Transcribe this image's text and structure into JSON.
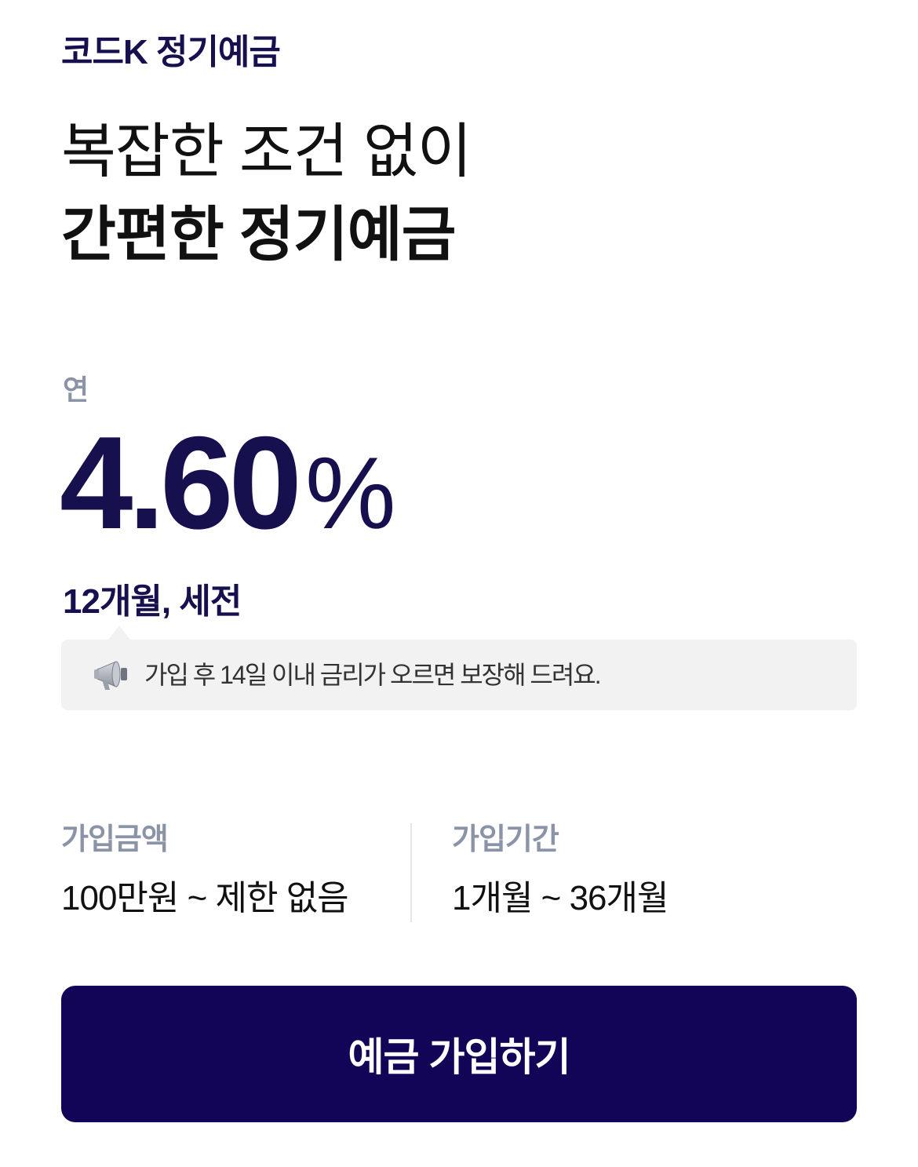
{
  "header": {
    "product_name": "코드K 정기예금"
  },
  "headline": {
    "line1": "복잡한 조건 없이",
    "line2": "간편한 정기예금"
  },
  "rate": {
    "prefix": "연",
    "value": "4.60",
    "unit": "%",
    "condition": "12개월, 세전"
  },
  "notice": {
    "icon": "megaphone-icon",
    "text": "가입 후 14일 이내 금리가 오르면 보장해 드려요."
  },
  "info": {
    "amount": {
      "label": "가입금액",
      "value": "100만원 ~ 제한 없음"
    },
    "period": {
      "label": "가입기간",
      "value": "1개월 ~ 36개월"
    }
  },
  "cta": {
    "label": "예금 가입하기"
  },
  "colors": {
    "brand": "#16104f",
    "button": "#120457",
    "muted": "#8b94a7",
    "notice_bg": "#f2f2f3"
  }
}
